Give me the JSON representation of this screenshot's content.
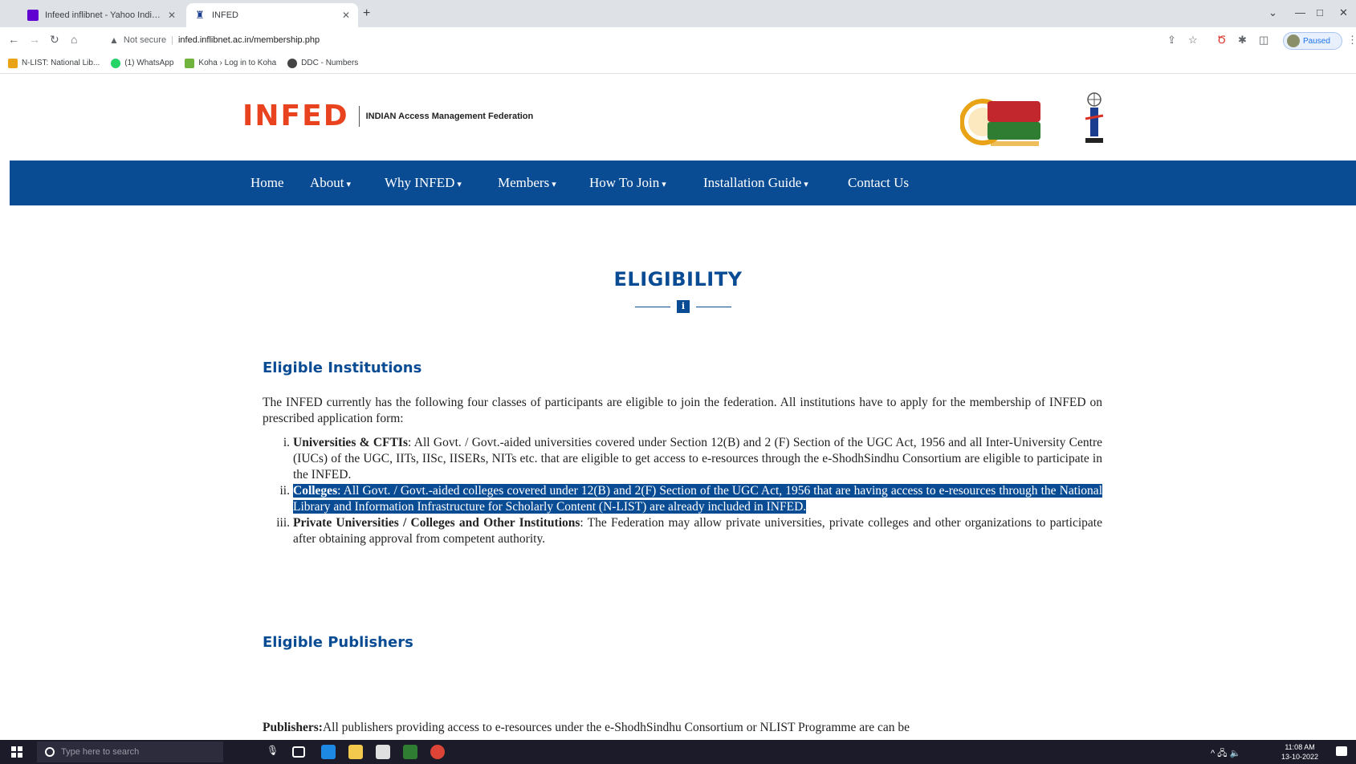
{
  "browser": {
    "tabs": [
      {
        "title": "Infeed inflibnet - Yahoo India Se",
        "active": false
      },
      {
        "title": "INFED",
        "active": true
      }
    ],
    "new_tab": "+",
    "controls": {
      "minimize": "—",
      "maximize": "□",
      "close": "✕",
      "collapse": "⌄"
    },
    "address": {
      "security": "Not secure",
      "url": "infed.inflibnet.ac.in/membership.php"
    },
    "profile": "Paused",
    "bookmarks": [
      {
        "label": "N-LIST: National Lib...",
        "color": "#e8a317"
      },
      {
        "label": "(1) WhatsApp",
        "color": "#25d366"
      },
      {
        "label": "Koha › Log in to Koha",
        "color": "#71b43d"
      },
      {
        "label": "DDC - Numbers",
        "color": "#444444"
      }
    ]
  },
  "site": {
    "logo": {
      "main": "INFED",
      "sub": "INDIAN Access Management Federation"
    },
    "partner_logos": [
      "e-ShodhSindhu",
      "INFLIBNET"
    ],
    "nav": [
      {
        "label": "Home",
        "dropdown": false
      },
      {
        "label": "About",
        "dropdown": true
      },
      {
        "label": "Why INFED",
        "dropdown": true
      },
      {
        "label": "Members",
        "dropdown": true
      },
      {
        "label": "How To Join",
        "dropdown": true
      },
      {
        "label": "Installation Guide",
        "dropdown": true
      },
      {
        "label": "Contact Us",
        "dropdown": false
      }
    ],
    "caret": "▾",
    "page_title": "ELIGIBILITY",
    "title_icon": "info-icon",
    "eligible_institutions": {
      "heading": "Eligible Institutions",
      "intro": "The INFED currently has the following four classes of participants are eligible to join the federation. All institutions have to apply for the membership of INFED on prescribed application form:",
      "items": [
        {
          "num": "i.",
          "bold": "Universities & CFTIs",
          "text": ": All Govt. / Govt.-aided universities covered under Section 12(B) and 2 (F) Section of the UGC Act, 1956 and all Inter-University Centre (IUCs) of the UGC, IITs, IISc, IISERs, NITs etc. that are eligible to get access to e-resources through the e-ShodhSindhu Consortium are eligible to participate in the INFED.",
          "selected": false
        },
        {
          "num": "ii.",
          "bold": "Colleges",
          "text": ":  All Govt. / Govt.-aided colleges covered under 12(B) and 2(F) Section of the UGC Act, 1956 that are having access to e-resources through the National Library and Information Infrastructure for Scholarly Content (N-LIST) are already included in INFED.",
          "selected": true
        },
        {
          "num": "iii.",
          "bold": "Private Universities / Colleges and Other Institutions",
          "text": ": The Federation may allow private universities, private colleges and other organizations to participate after obtaining approval from competent authority.",
          "selected": false
        }
      ]
    },
    "eligible_publishers": {
      "heading": "Eligible Publishers",
      "bold": "Publishers:",
      "text": "All publishers providing access to e-resources under the e-ShodhSindhu Consortium or NLIST Programme are can be"
    }
  },
  "taskbar": {
    "search_placeholder": "Type here to search",
    "apps": [
      {
        "name": "edge",
        "color": "#1e88e5"
      },
      {
        "name": "file-explorer",
        "color": "#f2c94c"
      },
      {
        "name": "store",
        "color": "#e0e0e0"
      },
      {
        "name": "spreadsheet",
        "color": "#2e7d32"
      },
      {
        "name": "chrome",
        "color": "#db4437"
      }
    ],
    "tray": "^ 🖧 🔈",
    "time": "11:08 AM",
    "date": "13-10-2022"
  }
}
